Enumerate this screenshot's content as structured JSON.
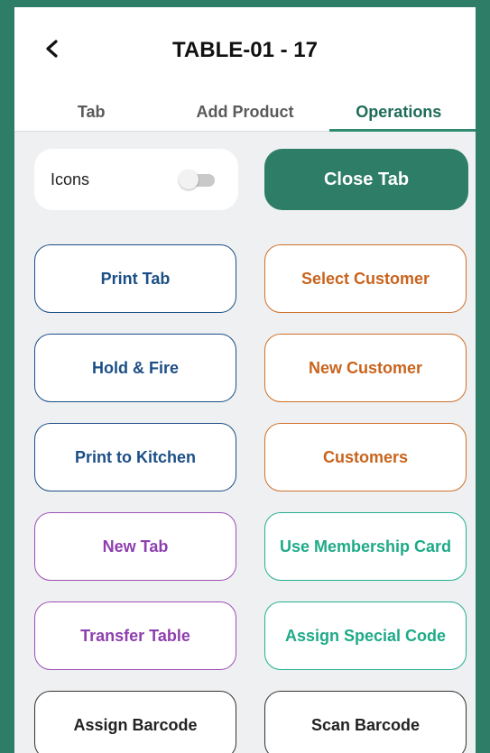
{
  "header": {
    "title": "TABLE-01 - 17",
    "back_icon": "chevron-left-icon"
  },
  "tabs": [
    {
      "label": "Tab",
      "active": false
    },
    {
      "label": "Add Product",
      "active": false
    },
    {
      "label": "Operations",
      "active": true
    }
  ],
  "toggle": {
    "label": "Icons",
    "value": false
  },
  "close_tab": {
    "label": "Close Tab"
  },
  "buttons": [
    {
      "label": "Print Tab",
      "color": "#1c4f86"
    },
    {
      "label": "Select Customer",
      "color": "#d0702a"
    },
    {
      "label": "Hold & Fire",
      "color": "#1c4f86"
    },
    {
      "label": "New Customer",
      "color": "#d0702a"
    },
    {
      "label": "Print to Kitchen",
      "color": "#1c4f86"
    },
    {
      "label": "Customers",
      "color": "#d0702a"
    },
    {
      "label": "New Tab",
      "color": "#9c4fb6"
    },
    {
      "label": "Use Membership Card",
      "color": "#25b090"
    },
    {
      "label": "Transfer Table",
      "color": "#9c4fb6"
    },
    {
      "label": "Assign Special Code",
      "color": "#25b090"
    },
    {
      "label": "Assign Barcode",
      "color": "#333333"
    },
    {
      "label": "Scan Barcode",
      "color": "#333333"
    }
  ],
  "colors": {
    "brand": "#2e7d66",
    "accent": "#2e8b6f",
    "background": "#eef0f2"
  }
}
